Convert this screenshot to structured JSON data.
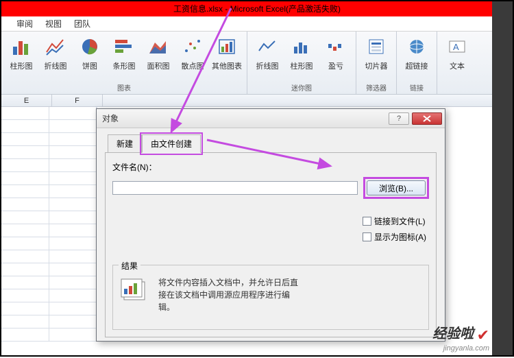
{
  "titlebar": "工资信息.xlsx - Microsoft Excel(产品激活失败)",
  "tabs": {
    "t1": "审阅",
    "t2": "视图",
    "t3": "团队"
  },
  "ribbon": {
    "items": [
      {
        "label": "柱形图"
      },
      {
        "label": "折线图"
      },
      {
        "label": "饼图"
      },
      {
        "label": "条形图"
      },
      {
        "label": "面积图"
      },
      {
        "label": "散点图"
      },
      {
        "label": "其他图表"
      }
    ],
    "group1": "图表",
    "mini": [
      {
        "label": "折线图"
      },
      {
        "label": "柱形图"
      },
      {
        "label": "盈亏"
      }
    ],
    "group2": "迷你图",
    "slicer": "切片器",
    "group3": "筛选器",
    "link": "超链接",
    "group4": "链接",
    "textbox": "文本"
  },
  "cols": {
    "e": "E",
    "f": "F"
  },
  "dialog": {
    "title": "对象",
    "help": "?",
    "tab_new": "新建",
    "tab_fromfile": "由文件创建",
    "filename_label": "文件名(N)：",
    "filename_value": "",
    "browse": "浏览(B)...",
    "chk_link": "链接到文件(L)",
    "chk_icon": "显示为图标(A)",
    "result_label": "结果",
    "result_text": "将文件内容插入文档中，并允许日后直接在该文档中调用源应用程序进行编辑。"
  },
  "watermark": {
    "t1": "经验啦",
    "t2": "jingyanla.com"
  }
}
